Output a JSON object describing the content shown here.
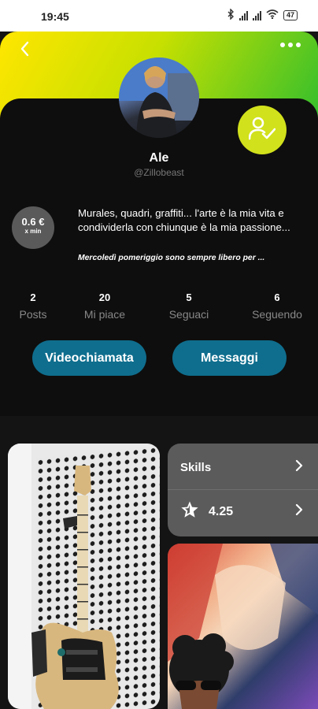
{
  "status_bar": {
    "time": "19:45",
    "battery": "47"
  },
  "profile": {
    "name": "Ale",
    "handle": "@Zillobeast",
    "price_value": "0.6 €",
    "price_unit": "x min",
    "bio": "Murales, quadri, graffiti... l'arte è la mia vita e condividerla con chiunque è la mia passione...",
    "note": "Mercoledì pomeriggio sono sempre libero per ..."
  },
  "stats": [
    {
      "value": "2",
      "label": "Posts"
    },
    {
      "value": "20",
      "label": "Mi piace"
    },
    {
      "value": "5",
      "label": "Seguaci"
    },
    {
      "value": "6",
      "label": "Seguendo"
    }
  ],
  "actions": {
    "video_call": "Videochiamata",
    "messages": "Messaggi"
  },
  "skills": {
    "title": "Skills",
    "rating": "4.25"
  },
  "icons": [
    "back-arrow-icon",
    "more-dots-icon",
    "follow-user-check-icon",
    "chevron-right-icon",
    "star-icon"
  ],
  "colors": {
    "accent_yellow": "#d1e11b",
    "button_blue": "#0f6e8e",
    "header_gradient_start": "#ffe600",
    "header_gradient_end": "#35bf2c"
  }
}
